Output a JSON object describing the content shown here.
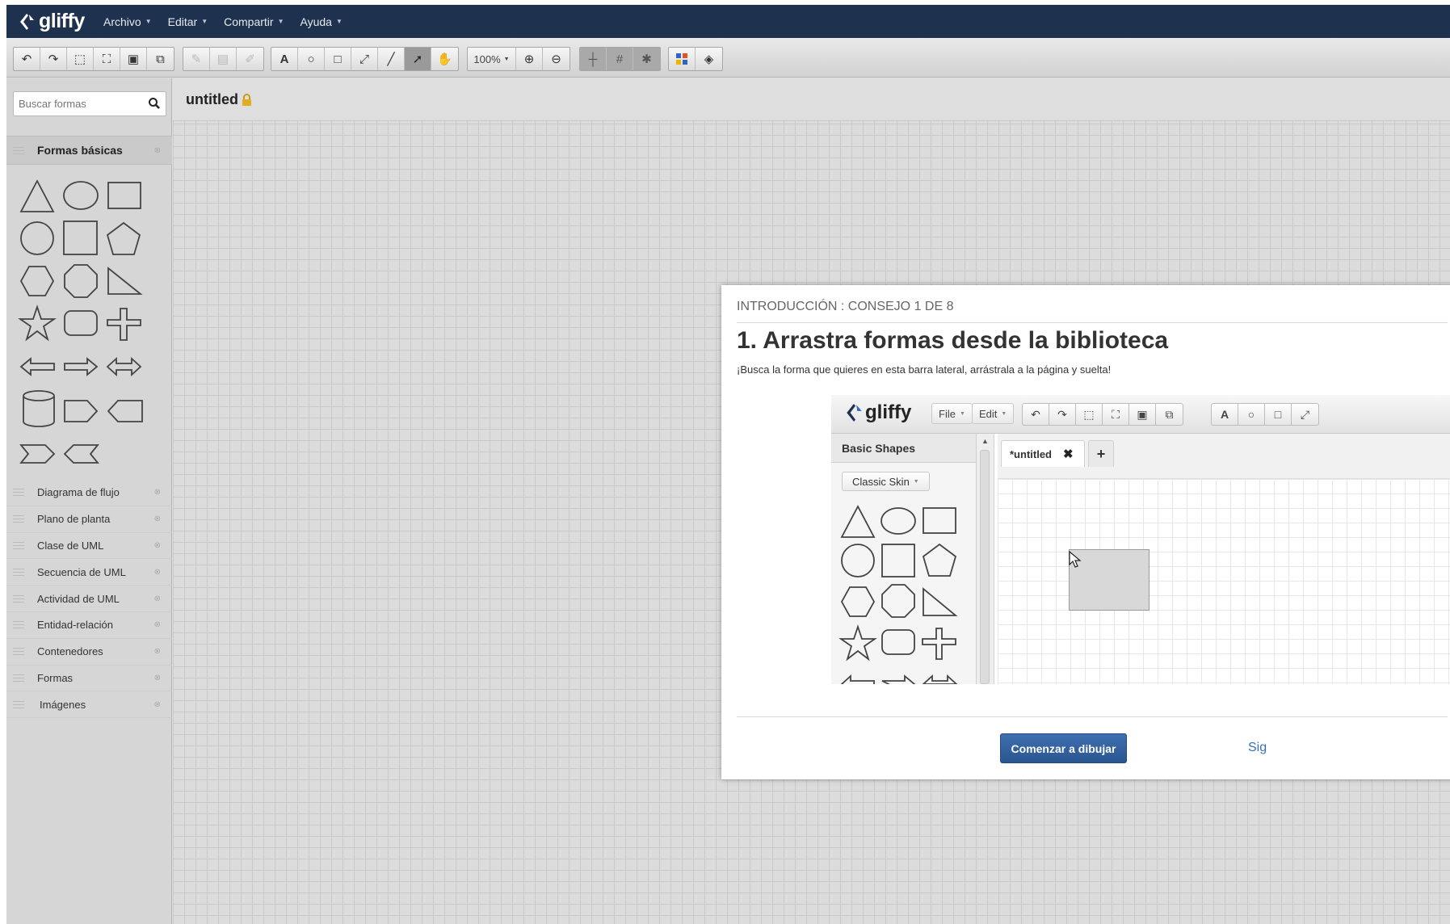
{
  "app": {
    "logo_text": "gliffy",
    "menu": [
      {
        "label": "Archivo"
      },
      {
        "label": "Editar"
      },
      {
        "label": "Compartir"
      },
      {
        "label": "Ayuda"
      }
    ]
  },
  "toolbar": {
    "zoom_level": "100%"
  },
  "sidebar": {
    "search_placeholder": "Buscar formas",
    "active_category": "Formas básicas",
    "categories": [
      {
        "label": "Diagrama de flujo"
      },
      {
        "label": "Plano de planta"
      },
      {
        "label": "Clase de UML"
      },
      {
        "label": "Secuencia de UML"
      },
      {
        "label": "Actividad de UML"
      },
      {
        "label": "Entidad-relación"
      },
      {
        "label": "Contenedores"
      },
      {
        "label": "Formas"
      },
      {
        "label": "Imágenes"
      }
    ]
  },
  "document": {
    "title": "untitled"
  },
  "dialog": {
    "step": "INTRODUCCIÓN :  CONSEJO 1 DE 8",
    "title": "1. Arrastra formas desde la biblioteca",
    "description": "¡Busca la forma que quieres en esta barra lateral, arrástrala a la página y suelta!",
    "start_button": "Comenzar a dibujar",
    "next_link": "Sig",
    "tutorial": {
      "logo_text": "gliffy",
      "file_menu": "File",
      "edit_menu": "Edit",
      "sidebar_title": "Basic Shapes",
      "skin_select": "Classic Skin",
      "tab_title": "*untitled",
      "tab_close": "✖",
      "tab_add": "+"
    }
  },
  "colors": {
    "menubar": "#1e3250",
    "primary_button": "#2f5e9e",
    "link": "#3a6fb3"
  }
}
